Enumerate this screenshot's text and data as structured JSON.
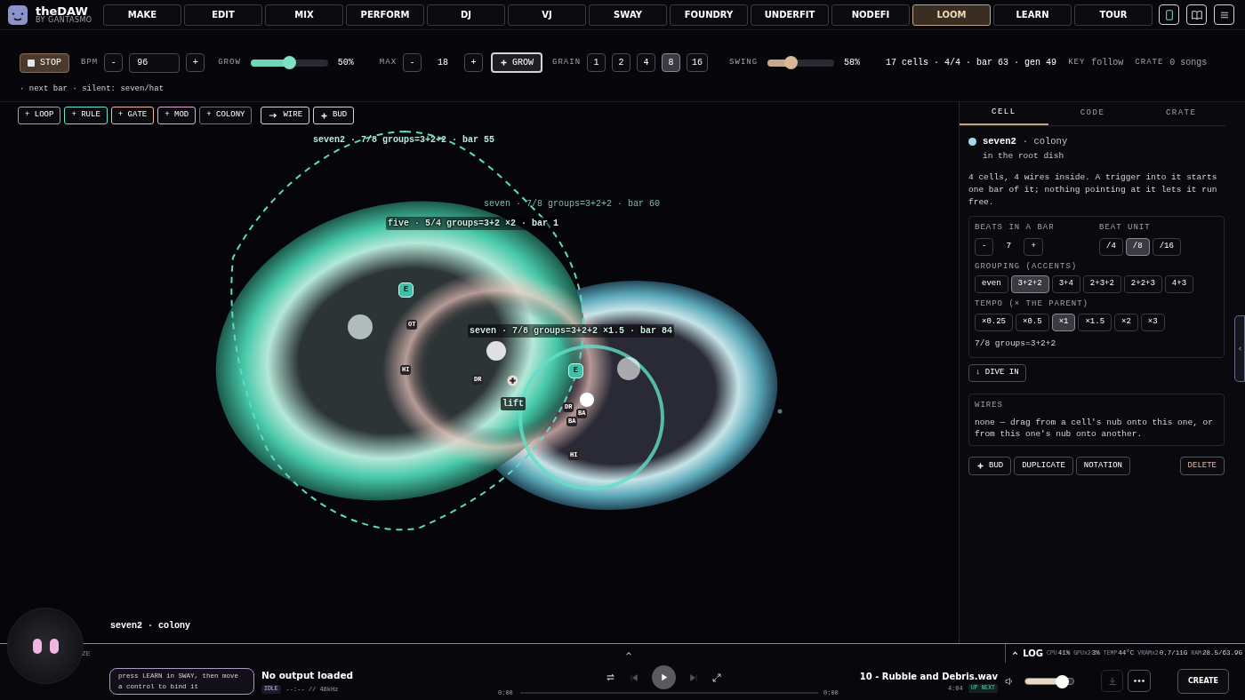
{
  "app": {
    "title": "theDAW",
    "subtitle": "BY GANTASMO"
  },
  "nav": {
    "tabs": [
      {
        "label": "MAKE",
        "selected": false
      },
      {
        "label": "EDIT",
        "selected": false
      },
      {
        "label": "MIX",
        "selected": false
      },
      {
        "label": "PERFORM",
        "selected": false
      },
      {
        "label": "DJ",
        "selected": false
      },
      {
        "label": "VJ",
        "selected": false
      },
      {
        "label": "SWAY",
        "selected": false
      },
      {
        "label": "FOUNDRY",
        "selected": false
      },
      {
        "label": "UNDERFIT",
        "selected": false
      },
      {
        "label": "NODEFI",
        "selected": false
      },
      {
        "label": "LOOM",
        "selected": true
      },
      {
        "label": "LEARN",
        "selected": false
      },
      {
        "label": "TOUR",
        "selected": false
      }
    ]
  },
  "toolbar": {
    "stop": "STOP",
    "bpm": {
      "label": "BPM",
      "minus": "-",
      "value": "96",
      "plus": "+"
    },
    "grow": {
      "label": "GROW",
      "level": 0.5,
      "reading": "50%"
    },
    "max": {
      "label": "MAX",
      "minus": "-",
      "value": "18",
      "plus": "+"
    },
    "grow_button": "GROW",
    "grain": {
      "label": "GRAIN",
      "options": [
        {
          "label": "1",
          "selected": false
        },
        {
          "label": "2",
          "selected": false
        },
        {
          "label": "4",
          "selected": false
        },
        {
          "label": "8",
          "selected": true
        },
        {
          "label": "16",
          "selected": false
        }
      ]
    },
    "swing": {
      "label": "SWING",
      "level": 0.35,
      "reading": "58%"
    },
    "stats": "17 cells · 4/4 · bar 63 · gen 49",
    "key_label": "KEY",
    "key_value": "follow",
    "crate_label": "CRATE",
    "crate_value": "0 songs"
  },
  "status_line": "· next bar · silent: seven/hat",
  "canvas": {
    "tools": [
      {
        "label": "+ LOOP",
        "kind": "add",
        "color": "#a1a1aa"
      },
      {
        "label": "+ RULE",
        "kind": "add",
        "color": "#5eead4"
      },
      {
        "label": "+ GATE",
        "kind": "add",
        "color": "#f4b8a0"
      },
      {
        "label": "+ MOD",
        "kind": "add",
        "color": "#e8a8d8"
      },
      {
        "label": "+ COLONY",
        "kind": "add",
        "color": "#71717a"
      },
      {
        "label": "WIRE",
        "kind": "wire",
        "color": "#d4d4d8"
      },
      {
        "label": "BUD",
        "kind": "bud",
        "color": "#d4d4d8"
      }
    ],
    "labels": [
      {
        "text": "seven2 · 7/8 groups=3+2+2 · bar 55",
        "kind": "plain"
      },
      {
        "text": "seven · 7/8 groups=3+2+2 · bar 60",
        "kind": "dim"
      },
      {
        "text": "five · 5/4 groups=3+2 ×2 · bar 1",
        "kind": "outlined"
      },
      {
        "text": "seven · 7/8 groups=3+2+2 ×1.5 · bar 84",
        "kind": "outlined"
      }
    ],
    "cells": [
      {
        "label": "E"
      },
      {
        "label": "OT"
      },
      {
        "label": "HI"
      },
      {
        "label": "DR"
      },
      {
        "label": "lift"
      },
      {
        "label": "E"
      },
      {
        "label": "DR"
      },
      {
        "label": "BA"
      },
      {
        "label": "BA"
      },
      {
        "label": "HI"
      }
    ],
    "caption": "seven2 · colony"
  },
  "panel": {
    "tabs": [
      {
        "label": "CELL",
        "selected": true
      },
      {
        "label": "CODE",
        "selected": false
      },
      {
        "label": "CRATE",
        "selected": false
      }
    ],
    "cell": {
      "color": "#a5d8ec",
      "name": "seven2",
      "kind": "· colony",
      "location": "in the root dish",
      "description": "4 cells, 4 wires inside. A trigger into it starts one bar of it; nothing pointing at it lets it run free."
    },
    "beats": {
      "label": "BEATS IN A BAR",
      "minus": "-",
      "value": "7",
      "plus": "+"
    },
    "unit": {
      "label": "BEAT UNIT",
      "options": [
        {
          "label": "/4",
          "selected": false
        },
        {
          "label": "/8",
          "selected": true
        },
        {
          "label": "/16",
          "selected": false
        }
      ]
    },
    "grouping": {
      "label": "GROUPING (ACCENTS)",
      "options": [
        {
          "label": "even",
          "selected": false
        },
        {
          "label": "3+2+2",
          "selected": true
        },
        {
          "label": "3+4",
          "selected": false
        },
        {
          "label": "2+3+2",
          "selected": false
        },
        {
          "label": "2+2+3",
          "selected": false
        },
        {
          "label": "4+3",
          "selected": false
        }
      ]
    },
    "tempo": {
      "label": "TEMPO (× THE PARENT)",
      "options": [
        {
          "label": "×0.25",
          "selected": false
        },
        {
          "label": "×0.5",
          "selected": false
        },
        {
          "label": "×1",
          "selected": true
        },
        {
          "label": "×1.5",
          "selected": false
        },
        {
          "label": "×2",
          "selected": false
        },
        {
          "label": "×3",
          "selected": false
        }
      ]
    },
    "summary": "7/8 groups=3+2+2",
    "dive": "↓ DIVE IN",
    "wires": {
      "title": "WIRES",
      "text": "none — drag from a cell's nub onto this one, or from this one's nub onto another."
    },
    "actions": [
      {
        "label": "BUD",
        "kind": "bud"
      },
      {
        "label": "DUPLICATE",
        "kind": "plain"
      },
      {
        "label": "NOTATION",
        "kind": "plain"
      },
      {
        "label": "DELETE",
        "kind": "danger"
      }
    ]
  },
  "strip": {
    "left_text": "ZE",
    "log": "LOG",
    "metrics": [
      {
        "label": "CPU",
        "value": "41%"
      },
      {
        "label": "GPUx2",
        "value": "3%"
      },
      {
        "label": "TEMP",
        "value": "44°C"
      },
      {
        "label": "VRAMx2",
        "value": "0.7/11G"
      },
      {
        "label": "RAM",
        "value": "28.5/63.9G"
      }
    ]
  },
  "player": {
    "hint": "press LEARN in SWAY, then move a control to bind it",
    "output": "No output loaded",
    "state": "IDLE",
    "format": "--:-- // 48kHz",
    "time_start": "0:00",
    "time_end": "0:00",
    "track": "10 - Rubble and Debris.wav",
    "duration": "4:04",
    "next": "UP NEXT",
    "volume": {
      "level": 0.75
    },
    "create": "CREATE"
  }
}
